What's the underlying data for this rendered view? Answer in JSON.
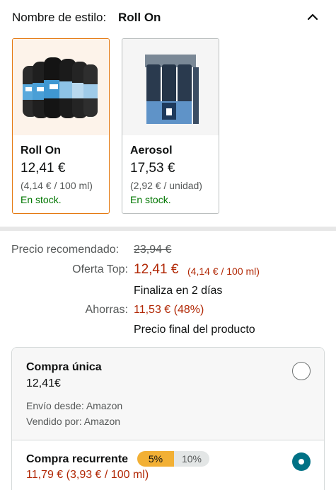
{
  "style": {
    "label": "Nombre de estilo:",
    "value": "Roll On"
  },
  "options": [
    {
      "title": "Roll On",
      "price": "12,41 €",
      "unit_price": "(4,14 € / 100 ml)",
      "stock": "En stock.",
      "selected": true,
      "image": "roll-on-pack-image"
    },
    {
      "title": "Aerosol",
      "price": "17,53 €",
      "unit_price": "(2,92 € / unidad)",
      "stock": "En stock.",
      "selected": false,
      "image": "aerosol-pack-image"
    }
  ],
  "pricing": {
    "recommended_label": "Precio recomendado:",
    "recommended_price": "23,94 €",
    "offer_label": "Oferta Top:",
    "offer_price": "12,41 €",
    "offer_unit": "(4,14 € / 100 ml)",
    "offer_ends": "Finaliza en 2 días",
    "savings_label": "Ahorras:",
    "savings_value": "11,53 € (48%)",
    "final_note": "Precio final del producto"
  },
  "purchase": {
    "one_time": {
      "title": "Compra única",
      "price": "12,41€",
      "shipped_by": "Envío desde: Amazon",
      "sold_by": "Vendido por: Amazon"
    },
    "recurring": {
      "title": "Compra recurrente",
      "badge_low": "5%",
      "badge_high": "10%",
      "price": "11,79 € (3,93 € / 100 ml)"
    }
  },
  "colors": {
    "accent_orange": "#e47911",
    "deal_red": "#b12704",
    "stock_green": "#007600",
    "radio_teal": "#007185",
    "badge_yellow": "#f2b035"
  }
}
